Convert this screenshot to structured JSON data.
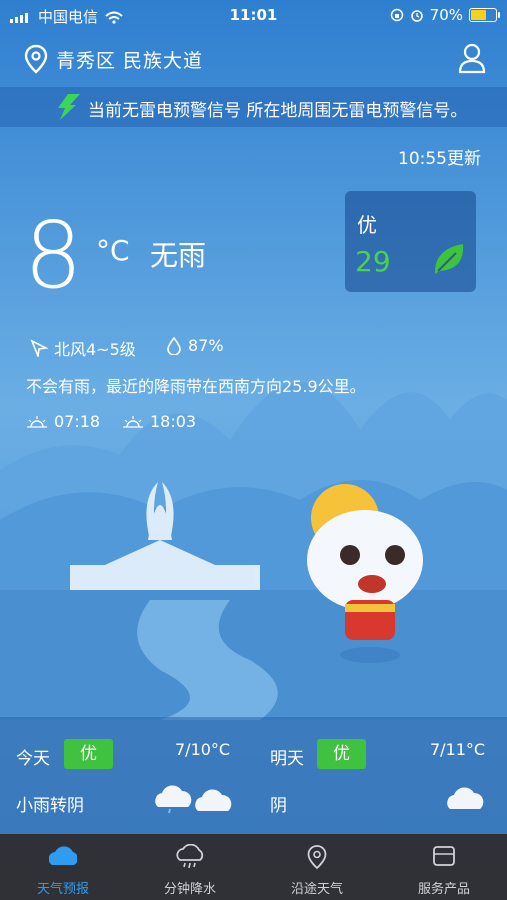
{
  "status_bar": {
    "carrier": "中国电信",
    "time": "11:01",
    "battery": "70%",
    "battery_level": 0.7
  },
  "header": {
    "location": "青秀区 民族大道"
  },
  "warning": {
    "text": "当前无雷电预警信号 所在地周围无雷电预警信号。"
  },
  "weather": {
    "updated": "10:55更新",
    "temperature": "8",
    "unit": "°C",
    "condition": "无雨",
    "aqi_label": "优",
    "aqi_value": "29",
    "wind": "北风4~5级",
    "humidity": "87%",
    "rain_note": "不会有雨，最近的降雨带在西南方向25.9公里。",
    "sunrise": "07:18",
    "sunset": "18:03"
  },
  "forecast": [
    {
      "day": "今天",
      "aqi": "优",
      "range": "7/10°C",
      "desc": "小雨转阴"
    },
    {
      "day": "明天",
      "aqi": "优",
      "range": "7/11°C",
      "desc": "阴"
    }
  ],
  "tabs": [
    {
      "label": "天气预报",
      "icon": "cloud-icon"
    },
    {
      "label": "分钟降水",
      "icon": "rain-cloud-icon"
    },
    {
      "label": "沿途天气",
      "icon": "location-pin-icon"
    },
    {
      "label": "服务产品",
      "icon": "box-icon"
    }
  ],
  "colors": {
    "sky_top": "#2f7fd0",
    "accent_green": "#3fc23f",
    "tab_active": "#2e9cf0",
    "tab_bar": "#2f3136"
  }
}
